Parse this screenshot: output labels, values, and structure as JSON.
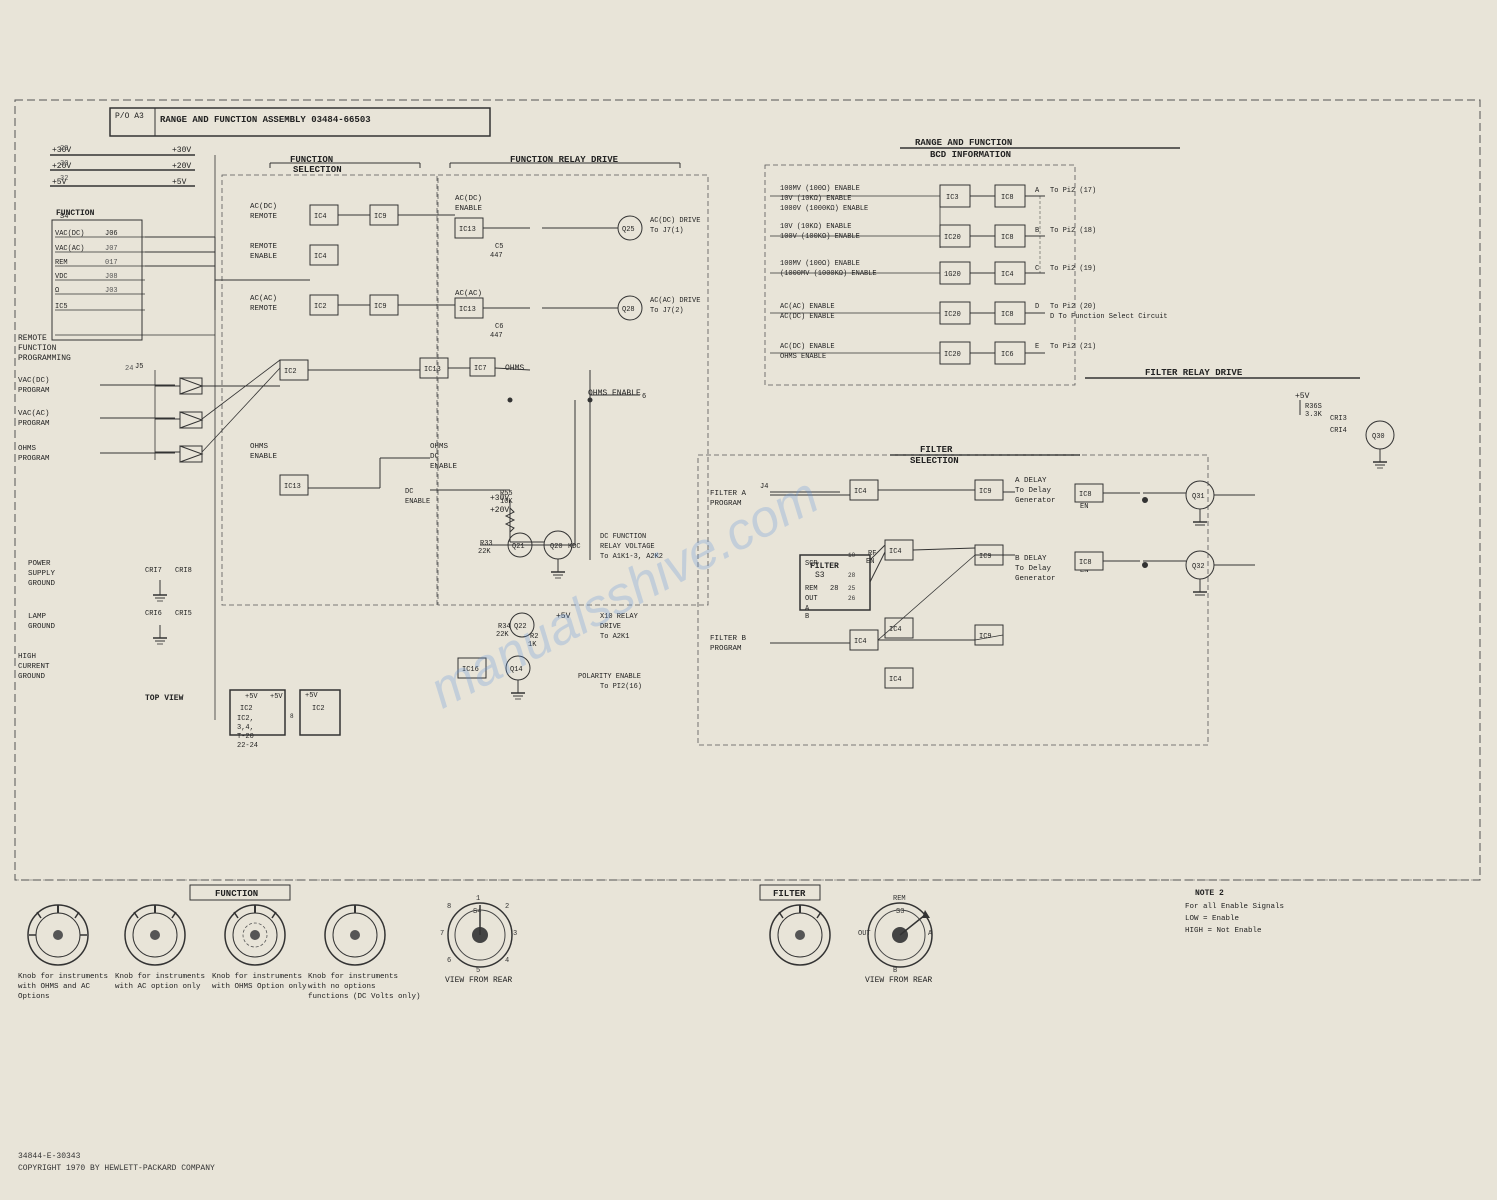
{
  "page": {
    "title": "Range and Function Assembly Schematic",
    "part_number": "P/O A3",
    "assembly_name": "RANGE AND FUNCTION ASSEMBLY  03484-66503",
    "copyright": "34844-E-30343\nCOPYRIGHT 1970 BY HEWLETT-PACKARD COMPANY",
    "watermark": "manualsshive.com",
    "sections": {
      "function_selection": "FUNCTION SELECTION",
      "function_relay_drive": "FUNCTION RELAY DRIVE",
      "range_function_bcd": "RANGE AND FUNCTION BCD INFORMATION",
      "filter_selection": "FILTER SELECTION",
      "filter_relay_drive": "FILTER RELAY DRIVE"
    },
    "notes": {
      "note2": "NOTE 2\nFor all Enable Signals\nLOW = Enable\nHIGH = Not Enable"
    },
    "knob_labels": [
      "Knob for instruments with OHMS and AC Options",
      "Knob for instruments with AC option only",
      "Knob for instruments with OHMS Option only",
      "Knob for instruments with no options (DC Volts only)"
    ],
    "view_labels": [
      "VIEW FROM REAR",
      "VIEW FROM REAR"
    ],
    "function_label": "FUNCTION",
    "filter_label": "FILTER",
    "s4_label": "S4",
    "s3_label": "S3"
  }
}
